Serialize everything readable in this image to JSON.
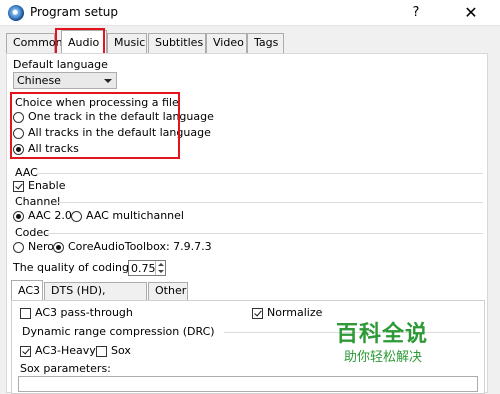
{
  "window": {
    "title": "Program setup",
    "help_glyph": "?",
    "close_glyph": "✕"
  },
  "tabs": [
    {
      "label": "Common"
    },
    {
      "label": "Audio",
      "active": true
    },
    {
      "label": "Music"
    },
    {
      "label": "Subtitles"
    },
    {
      "label": "Video"
    },
    {
      "label": "Tags"
    }
  ],
  "default_language": {
    "label": "Default language",
    "value": "Chinese"
  },
  "choice": {
    "label": "Choice when processing a file",
    "options": [
      {
        "label": "One track in the default language",
        "selected": false
      },
      {
        "label": "All tracks in the default language",
        "selected": false
      },
      {
        "label": "All tracks",
        "selected": true
      }
    ]
  },
  "aac": {
    "label": "AAC",
    "enable_label": "Enable",
    "enable_checked": true,
    "channel": {
      "label": "Channel",
      "options": [
        {
          "label": "AAC 2.0",
          "selected": true
        },
        {
          "label": "AAC multichannel",
          "selected": false
        }
      ]
    },
    "codec": {
      "label": "Codec",
      "nero_label": "Nero",
      "nero_selected": false,
      "core_label": "CoreAudioToolbox: 7.9.7.3",
      "core_selected": true
    },
    "quality_label": "The quality of coding",
    "quality_value": "0.75"
  },
  "subtabs": [
    {
      "label": "AC3",
      "active": true
    },
    {
      "label": "DTS (HD), TrueHD"
    },
    {
      "label": "Other"
    }
  ],
  "ac3": {
    "passthrough_label": "AC3 pass-through",
    "passthrough_checked": false,
    "normalize_label": "Normalize",
    "normalize_checked": true,
    "drc_label": "Dynamic range compression (DRC)",
    "heavy_label": "AC3-Heavy",
    "heavy_checked": true,
    "sox_label": "Sox",
    "sox_checked": false,
    "sox_params_label": "Sox parameters:"
  },
  "watermark": {
    "logo": "百科全说",
    "sub": "助你轻松解决"
  },
  "colors": {
    "highlight": "#e1151b",
    "watermark": "#2d9a37"
  }
}
